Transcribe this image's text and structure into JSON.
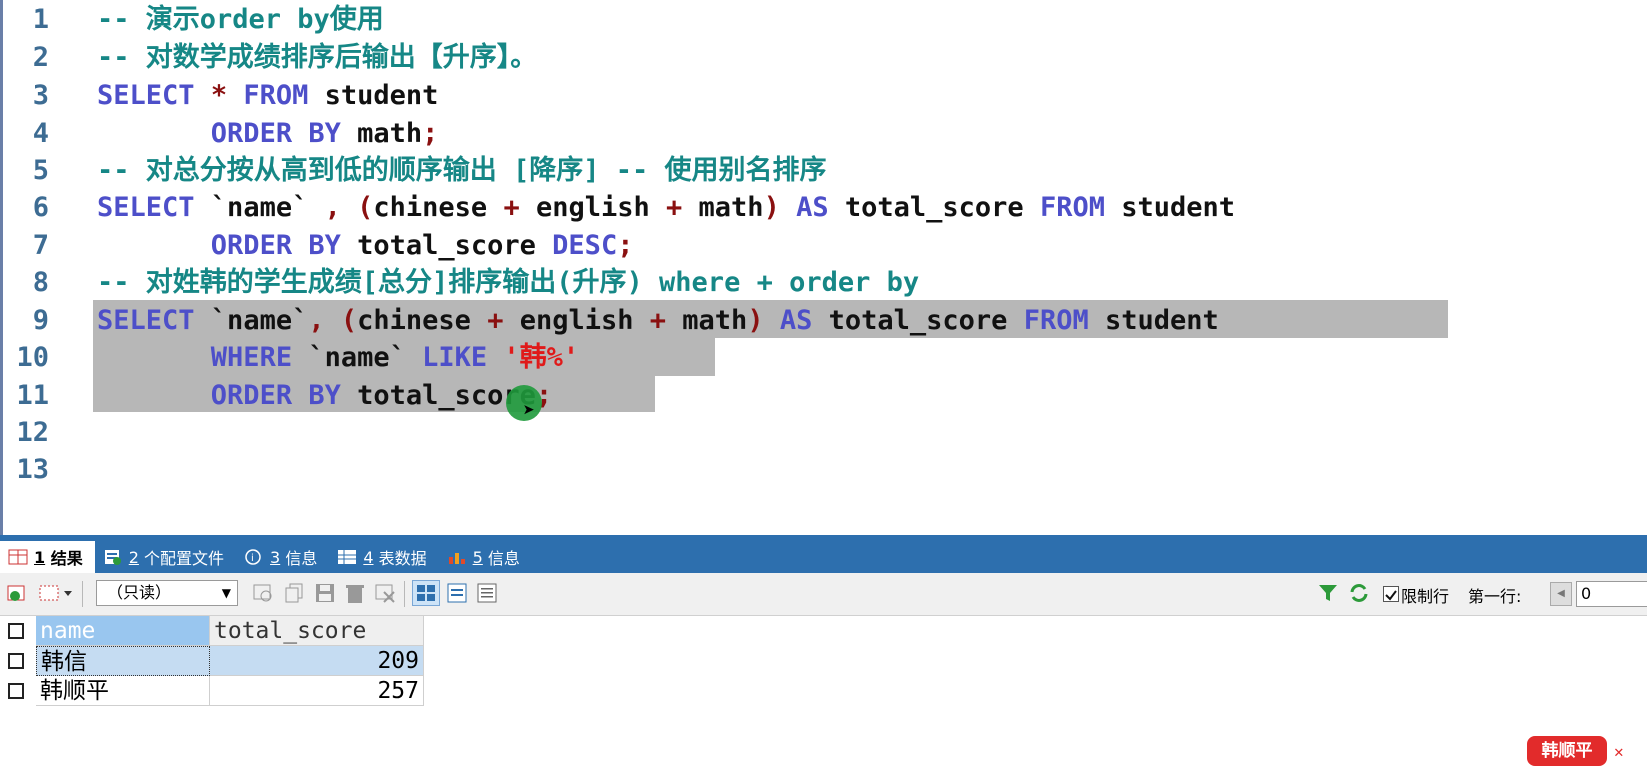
{
  "editor": {
    "lines": [
      {
        "no": "1",
        "tokens": [
          {
            "t": "cm",
            "v": "-- 演示order by使用"
          }
        ]
      },
      {
        "no": "2",
        "tokens": [
          {
            "t": "cm",
            "v": "-- 对数学成绩排序后输出【升序】。"
          }
        ]
      },
      {
        "no": "3",
        "tokens": [
          {
            "t": "kw",
            "v": "SELECT"
          },
          {
            "t": "tx",
            "v": " "
          },
          {
            "t": "star",
            "v": "*"
          },
          {
            "t": "tx",
            "v": " "
          },
          {
            "t": "kw",
            "v": "FROM"
          },
          {
            "t": "tx",
            "v": " student"
          }
        ]
      },
      {
        "no": "4",
        "tokens": [
          {
            "t": "tx",
            "v": "       "
          },
          {
            "t": "kw",
            "v": "ORDER BY"
          },
          {
            "t": "tx",
            "v": " math"
          },
          {
            "t": "op",
            "v": ";"
          }
        ]
      },
      {
        "no": "5",
        "tokens": [
          {
            "t": "cm",
            "v": "-- 对总分按从高到低的顺序输出 [降序] -- 使用别名排序"
          }
        ]
      },
      {
        "no": "6",
        "tokens": [
          {
            "t": "kw",
            "v": "SELECT"
          },
          {
            "t": "tx",
            "v": " `name` "
          },
          {
            "t": "op",
            "v": ","
          },
          {
            "t": "tx",
            "v": " "
          },
          {
            "t": "op",
            "v": "("
          },
          {
            "t": "tx",
            "v": "chinese "
          },
          {
            "t": "op",
            "v": "+"
          },
          {
            "t": "tx",
            "v": " english "
          },
          {
            "t": "op",
            "v": "+"
          },
          {
            "t": "tx",
            "v": " math"
          },
          {
            "t": "op",
            "v": ")"
          },
          {
            "t": "tx",
            "v": " "
          },
          {
            "t": "kw",
            "v": "AS"
          },
          {
            "t": "tx",
            "v": " total_score "
          },
          {
            "t": "kw",
            "v": "FROM"
          },
          {
            "t": "tx",
            "v": " student"
          }
        ]
      },
      {
        "no": "7",
        "tokens": [
          {
            "t": "tx",
            "v": "       "
          },
          {
            "t": "kw",
            "v": "ORDER BY"
          },
          {
            "t": "tx",
            "v": " total_score "
          },
          {
            "t": "kw",
            "v": "DESC"
          },
          {
            "t": "op",
            "v": ";"
          }
        ]
      },
      {
        "no": "8",
        "tokens": [
          {
            "t": "cm",
            "v": "-- 对姓韩的学生成绩[总分]排序输出(升序) where + order by"
          }
        ]
      },
      {
        "no": "9",
        "tokens": [
          {
            "t": "kw",
            "v": "SELECT"
          },
          {
            "t": "tx",
            "v": " `name`"
          },
          {
            "t": "op",
            "v": ","
          },
          {
            "t": "tx",
            "v": " "
          },
          {
            "t": "op",
            "v": "("
          },
          {
            "t": "tx",
            "v": "chinese "
          },
          {
            "t": "op",
            "v": "+"
          },
          {
            "t": "tx",
            "v": " english "
          },
          {
            "t": "op",
            "v": "+"
          },
          {
            "t": "tx",
            "v": " math"
          },
          {
            "t": "op",
            "v": ")"
          },
          {
            "t": "tx",
            "v": " "
          },
          {
            "t": "kw",
            "v": "AS"
          },
          {
            "t": "tx",
            "v": " total_score "
          },
          {
            "t": "kw",
            "v": "FROM"
          },
          {
            "t": "tx",
            "v": " student"
          }
        ]
      },
      {
        "no": "10",
        "tokens": [
          {
            "t": "tx",
            "v": "       "
          },
          {
            "t": "kw",
            "v": "WHERE"
          },
          {
            "t": "tx",
            "v": " `name` "
          },
          {
            "t": "kw",
            "v": "LIKE"
          },
          {
            "t": "tx",
            "v": " "
          },
          {
            "t": "st",
            "v": "'韩%'"
          }
        ]
      },
      {
        "no": "11",
        "tokens": [
          {
            "t": "tx",
            "v": "       "
          },
          {
            "t": "kw",
            "v": "ORDER BY"
          },
          {
            "t": "tx",
            "v": " total_score"
          },
          {
            "t": "op",
            "v": ";"
          }
        ]
      },
      {
        "no": "12",
        "tokens": []
      },
      {
        "no": "13",
        "tokens": []
      }
    ]
  },
  "tabs": [
    {
      "num": "1",
      "label": "结果",
      "active": true
    },
    {
      "num": "2",
      "label": "个配置文件",
      "active": false
    },
    {
      "num": "3",
      "label": "信息",
      "active": false
    },
    {
      "num": "4",
      "label": "表数据",
      "active": false
    },
    {
      "num": "5",
      "label": "信息",
      "active": false
    }
  ],
  "toolbar": {
    "mode_select": "（只读）",
    "limit_rows_label": "限制行",
    "limit_rows_checked": true,
    "first_row_label": "第一行:",
    "first_row_value": "0"
  },
  "grid": {
    "columns": [
      "name",
      "total_score"
    ],
    "rows": [
      {
        "name": "韩信",
        "total_score": "209"
      },
      {
        "name": "韩顺平",
        "total_score": "257"
      }
    ]
  },
  "user_badge": "韩顺平",
  "colors": {
    "keyword": "#4d4fc9",
    "comment": "#168786",
    "string": "#e01a1a",
    "tabbar": "#2d6fae",
    "badge": "#e22b2b"
  }
}
